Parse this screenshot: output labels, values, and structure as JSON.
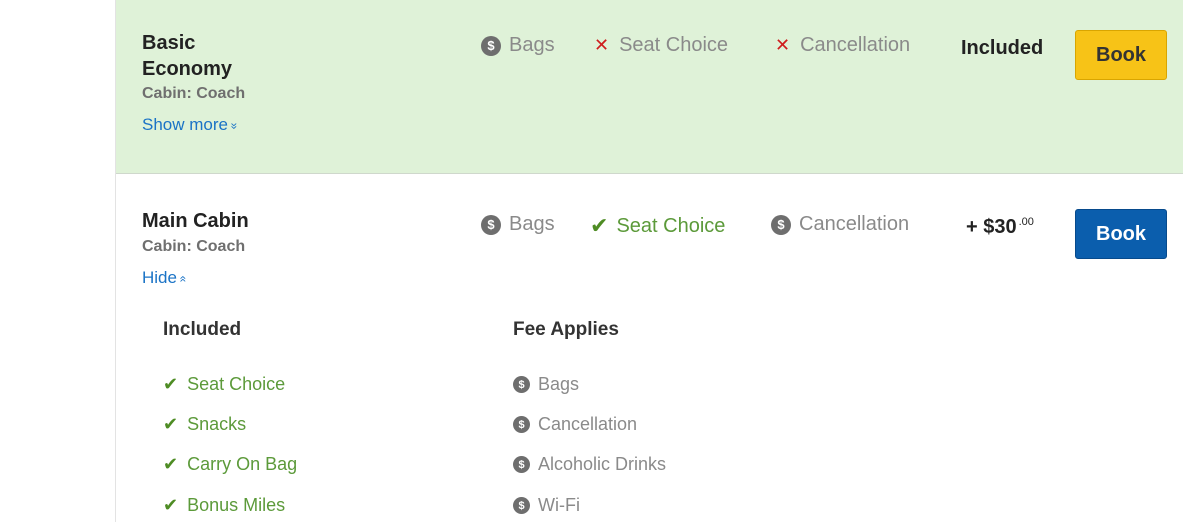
{
  "basic": {
    "name_line1": "Basic",
    "name_line2": "Economy",
    "cabin": "Cabin: Coach",
    "toggle": "Show more",
    "features": [
      {
        "label": "Bags",
        "status": "fee"
      },
      {
        "label": "Seat Choice",
        "status": "not-available"
      },
      {
        "label": "Cancellation",
        "status": "not-available"
      }
    ],
    "price": "Included",
    "book": "Book"
  },
  "main": {
    "name": "Main Cabin",
    "cabin": "Cabin: Coach",
    "toggle": "Hide",
    "features": [
      {
        "label": "Bags",
        "status": "fee"
      },
      {
        "label": "Seat Choice",
        "status": "included"
      },
      {
        "label": "Cancellation",
        "status": "fee"
      }
    ],
    "price": "+ $30",
    "price_cents": ".00",
    "book": "Book",
    "details": {
      "included_heading": "Included",
      "fee_heading": "Fee Applies",
      "included": [
        "Seat Choice",
        "Snacks",
        "Carry On Bag",
        "Bonus Miles"
      ],
      "fee": [
        "Bags",
        "Cancellation",
        "Alcoholic Drinks",
        "Wi-Fi"
      ]
    }
  },
  "icons": {
    "fee": "dollar-coin-icon",
    "not-available": "x-icon",
    "included": "check-icon",
    "coin_glyph": "$",
    "x_glyph": "✕",
    "check_glyph": "✔",
    "show_chevron": "»",
    "hide_chevron": "«"
  },
  "colors": {
    "basic_bg": "#dff2d8",
    "book_yellow": "#f7c317",
    "book_blue": "#0b5ead",
    "link": "#1a73c6",
    "included_green": "#5c9a3a",
    "x_red": "#cf1d1d"
  }
}
